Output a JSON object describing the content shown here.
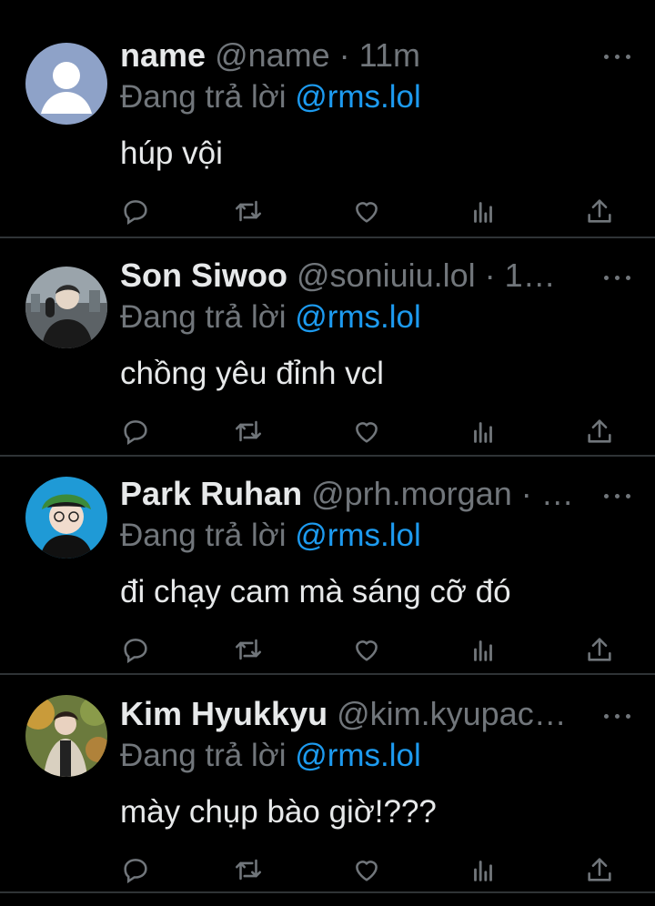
{
  "replies": [
    {
      "name": "name",
      "handle": "@name",
      "time": "11m",
      "reply_prefix": "Đang trả lời",
      "reply_to": "@rms.lol",
      "text": "húp vội",
      "avatar": "default-avatar"
    },
    {
      "name": "Son Siwoo",
      "handle": "@soniuiu.lol",
      "time": "1…",
      "reply_prefix": "Đang trả lời",
      "reply_to": "@rms.lol",
      "text": "chồng yêu đỉnh vcl",
      "avatar": "photo-avatar"
    },
    {
      "name": "Park Ruhan",
      "handle": "@prh.morgan",
      "time": "…",
      "reply_prefix": "Đang trả lời",
      "reply_to": "@rms.lol",
      "text": "đi chạy cam mà sáng cỡ đó",
      "avatar": "photo-avatar"
    },
    {
      "name": "Kim Hyukkyu",
      "handle": "@kim.kyupac…",
      "time": "",
      "reply_prefix": "Đang trả lời",
      "reply_to": "@rms.lol",
      "text": "mày chụp bào giờ!???",
      "avatar": "photo-avatar"
    }
  ],
  "icons": [
    "reply-icon",
    "retweet-icon",
    "like-icon",
    "views-icon",
    "share-icon",
    "more-icon"
  ],
  "colors": {
    "background": "#000000",
    "accent": "#1d9bf0",
    "muted": "#71767b",
    "text": "#e7e9ea"
  }
}
